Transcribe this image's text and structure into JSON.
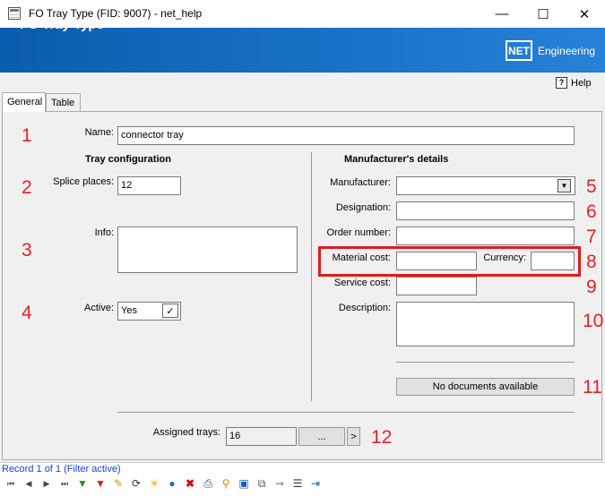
{
  "window": {
    "title": "FO Tray Type (FID: 9007) - net_help"
  },
  "banner": {
    "title": "FO Tray Type",
    "logo_mark": "NET",
    "logo_text": "Engineering"
  },
  "help": {
    "label": "Help"
  },
  "tabs": [
    {
      "label": "General",
      "active": true
    },
    {
      "label": "Table",
      "active": false
    }
  ],
  "form": {
    "name_label": "Name:",
    "name_value": "connector tray",
    "tray_config_header": "Tray configuration",
    "splice_label": "Splice places:",
    "splice_value": "12",
    "info_label": "Info:",
    "info_value": "",
    "active_label": "Active:",
    "active_value": "Yes",
    "manufacturer_header": "Manufacturer's details",
    "manufacturer_label": "Manufacturer:",
    "manufacturer_value": "",
    "designation_label": "Designation:",
    "designation_value": "",
    "order_label": "Order number:",
    "order_value": "",
    "material_cost_label": "Material cost:",
    "material_cost_value": "",
    "currency_label": "Currency:",
    "currency_value": "",
    "service_cost_label": "Service cost:",
    "service_cost_value": "",
    "description_label": "Description:",
    "description_value": "",
    "documents_button": "No documents available",
    "assigned_label": "Assigned trays:",
    "assigned_value": "16",
    "dots_button": "...",
    "next_button": ">"
  },
  "annotations": [
    "1",
    "2",
    "3",
    "4",
    "5",
    "6",
    "7",
    "8",
    "9",
    "10",
    "11",
    "12"
  ],
  "status": {
    "text": "Record 1 of 1 (Filter active)"
  },
  "colors": {
    "banner": "#1565c0",
    "annotation": "#e32222",
    "status_text": "#1a3fd8"
  }
}
